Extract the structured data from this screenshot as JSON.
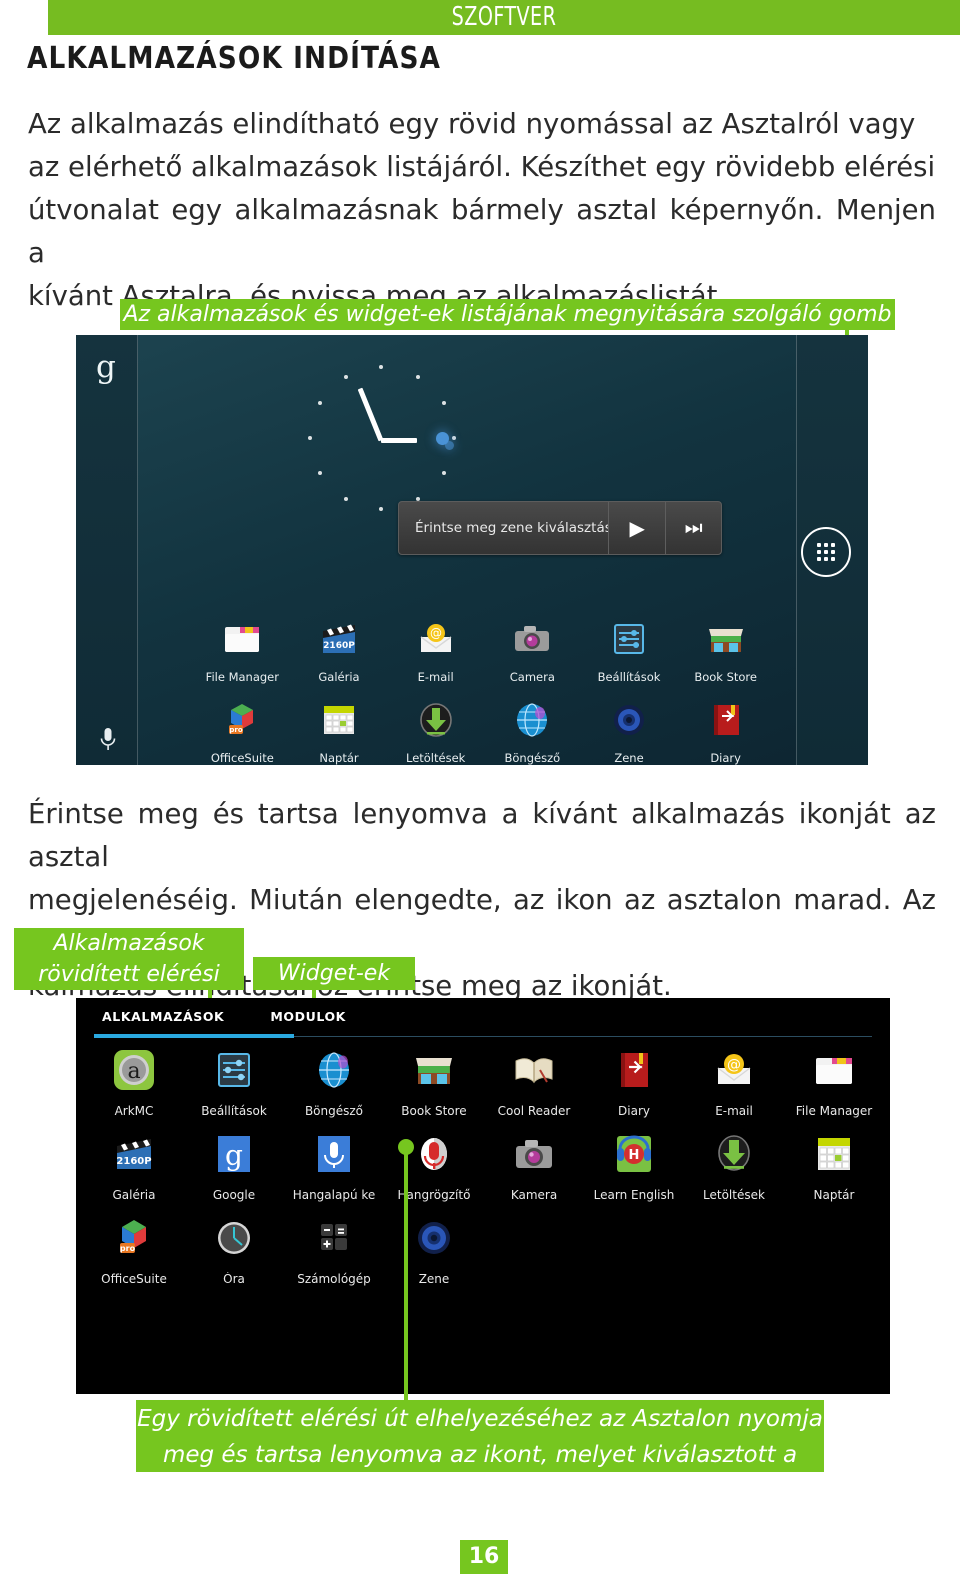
{
  "header": {
    "band_title": "SZOFTVER",
    "page_title": "ALKALMAZÁSOK INDÍTÁSA"
  },
  "paragraphs": {
    "p1_l1": "Az alkalmazás elindítható egy rövid nyomással az Asztalról vagy",
    "p1_l2": "az elérhető alkalmazások listájáról.  Készíthet egy rövidebb elérési",
    "p1_l3": "útvonalat egy alkalmazásnak bármely asztal képernyőn.  Menjen a",
    "p1_l4": "kívánt Asztalra, és nyissa meg az alkalmazáslistát.",
    "p2_l1": "Érintse meg és tartsa lenyomva a kívánt alkalmazás ikonját az asztal",
    "p2_l2": "megjelenéséig. Miután elengedte, az ikon az asztalon marad. Az al-",
    "p2_l3": "kalmazás elindításához érintse meg az ikonját."
  },
  "callouts": {
    "top": "Az alkalmazások és widget-ek listájának megnyitására szolgáló gomb",
    "apps_l1": "Alkalmazások",
    "apps_l2": "rövidített elérési útja",
    "widgets": "Widget-ek",
    "bottom_l1": "Egy rövidített elérési út elhelyezéséhez az Asztalon nyomja",
    "bottom_l2": "meg és tartsa lenyomva az ikont, melyet kiválasztott a listáról"
  },
  "homescreen": {
    "google_logo": "g",
    "mic_icon": "microphone-icon",
    "clock_widget": "analog-clock-widget",
    "drawer_button_icon": "app-drawer-grid-icon",
    "music_widget": {
      "label": "Érintse meg zene kiválasztásához",
      "play_icon": "▶",
      "next_icon": "⏭"
    },
    "icons": [
      {
        "label": "File Manager",
        "icon": "folder-icon"
      },
      {
        "label": "Galéria",
        "icon": "clapperboard-2160p-icon"
      },
      {
        "label": "E-mail",
        "icon": "envelope-at-icon"
      },
      {
        "label": "Camera",
        "icon": "camera-icon"
      },
      {
        "label": "Beállítások",
        "icon": "sliders-settings-icon"
      },
      {
        "label": "Book Store",
        "icon": "storefront-icon"
      },
      {
        "label": "OfficeSuite",
        "icon": "officesuite-cubes-pro-icon"
      },
      {
        "label": "Naptár",
        "icon": "calendar-icon"
      },
      {
        "label": "Letöltések",
        "icon": "download-arrow-icon"
      },
      {
        "label": "Böngésző",
        "icon": "globe-icon"
      },
      {
        "label": "Zene",
        "icon": "speaker-icon"
      },
      {
        "label": "Diary",
        "icon": "red-book-bookmark-icon"
      }
    ]
  },
  "appdrawer": {
    "tabs": [
      {
        "label": "ALKALMAZÁSOK",
        "selected": true
      },
      {
        "label": "MODULOK",
        "selected": false
      }
    ],
    "icons": [
      {
        "label": "ArkMC",
        "icon": "arkmc-a-icon"
      },
      {
        "label": "Beállítások",
        "icon": "sliders-settings-icon"
      },
      {
        "label": "Böngésző",
        "icon": "globe-icon"
      },
      {
        "label": "Book Store",
        "icon": "storefront-icon"
      },
      {
        "label": "Cool Reader",
        "icon": "open-book-icon"
      },
      {
        "label": "Diary",
        "icon": "red-book-bookmark-icon"
      },
      {
        "label": "E-mail",
        "icon": "envelope-at-icon"
      },
      {
        "label": "File Manager",
        "icon": "folder-icon"
      },
      {
        "label": "Galéria",
        "icon": "clapperboard-2160p-icon"
      },
      {
        "label": "Google",
        "icon": "google-g-icon"
      },
      {
        "label": "Hangalapú ke",
        "icon": "voice-search-mic-icon"
      },
      {
        "label": "Hangrögzítő",
        "icon": "voice-recorder-mic-icon"
      },
      {
        "label": "Kamera",
        "icon": "camera-icon"
      },
      {
        "label": "Learn English",
        "icon": "learn-english-headphones-icon"
      },
      {
        "label": "Letöltések",
        "icon": "download-arrow-icon"
      },
      {
        "label": "Naptár",
        "icon": "calendar-icon"
      },
      {
        "label": "OfficeSuite",
        "icon": "officesuite-cubes-pro-icon"
      },
      {
        "label": "Óra",
        "icon": "clock-icon"
      },
      {
        "label": "Számológép",
        "icon": "calculator-icon"
      },
      {
        "label": "Zene",
        "icon": "speaker-icon"
      }
    ]
  },
  "footer": {
    "page_number": "16"
  },
  "colors": {
    "accent_green": "#76c61f",
    "header_green": "#76bc21",
    "tab_blue": "#2aa9e0"
  }
}
